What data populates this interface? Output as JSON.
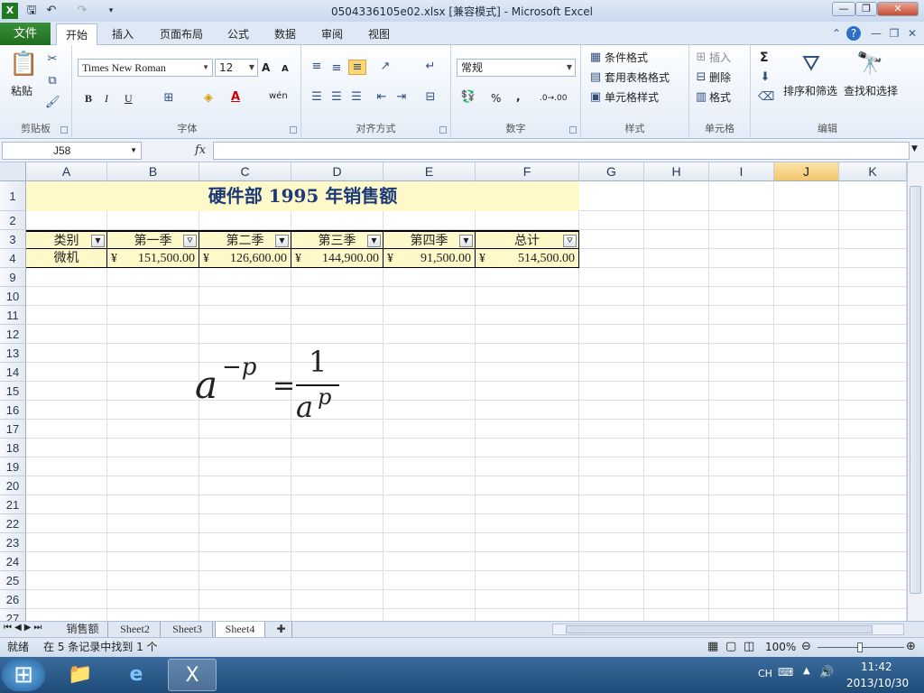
{
  "window": {
    "title": "0504336105e02.xlsx  [兼容模式]  -  Microsoft Excel",
    "min_glyph": "—",
    "max_glyph": "❐",
    "close_glyph": "✕"
  },
  "quick_access": [
    "save-icon",
    "undo-icon",
    "redo-icon",
    "customize-icon"
  ],
  "ribbon_tabs": {
    "file": "文件",
    "tabs": [
      "开始",
      "插入",
      "页面布局",
      "公式",
      "数据",
      "审阅",
      "视图"
    ],
    "active": "开始"
  },
  "ribbon": {
    "clipboard": {
      "label": "剪贴板",
      "paste": "粘贴"
    },
    "font": {
      "label": "字体",
      "name": "Times New Roman",
      "size": "12",
      "bold": "B",
      "italic": "I",
      "underline": "U",
      "grow": "A",
      "shrink": "A",
      "wen": "wén"
    },
    "alignment": {
      "label": "对齐方式"
    },
    "number": {
      "label": "数字",
      "format": "常规",
      "percent": "%",
      "comma": ",",
      "inc_dec": ".0→.00",
      "dec_dec": ".00→.0"
    },
    "styles": {
      "label": "样式",
      "conditional": "条件格式",
      "table": "套用表格格式",
      "cell": "单元格样式"
    },
    "cells": {
      "label": "单元格",
      "insert": "插入",
      "delete": "删除",
      "format": "格式"
    },
    "editing": {
      "label": "编辑",
      "sort": "排序和筛选",
      "find": "查找和选择",
      "sigma": "Σ"
    }
  },
  "formula_bar": {
    "name_box": "J58",
    "fx": "fx",
    "value": ""
  },
  "grid": {
    "columns": [
      "A",
      "B",
      "C",
      "D",
      "E",
      "F",
      "G",
      "H",
      "I",
      "J",
      "K"
    ],
    "selected_column": "J",
    "rows": [
      "1",
      "2",
      "3",
      "4",
      "9",
      "10",
      "11",
      "12",
      "13",
      "14",
      "15",
      "16",
      "17",
      "18",
      "19",
      "20",
      "21",
      "22",
      "23",
      "24",
      "25",
      "26",
      "27"
    ],
    "title": "硬件部  1995  年销售额",
    "headers": [
      "类别",
      "第一季",
      "第二季",
      "第三季",
      "第四季",
      "总计"
    ],
    "data_row": {
      "category": "微机",
      "currency": "¥",
      "values": [
        "151,500.00",
        "126,600.00",
        "144,900.00",
        "91,500.00",
        "514,500.00"
      ]
    }
  },
  "equation": {
    "base": "a",
    "neg_exp": "−p",
    "equals": "=",
    "numerator": "1",
    "denominator": "a",
    "den_exp": "p"
  },
  "sheets": {
    "tabs": [
      "销售额",
      "Sheet2",
      "Sheet3",
      "Sheet4"
    ],
    "active": "Sheet4"
  },
  "status": {
    "ready": "就绪",
    "message": "在 5 条记录中找到 1 个",
    "zoom": "100%"
  },
  "taskbar": {
    "lang": "CH",
    "time": "11:42",
    "date": "2013/10/30"
  }
}
